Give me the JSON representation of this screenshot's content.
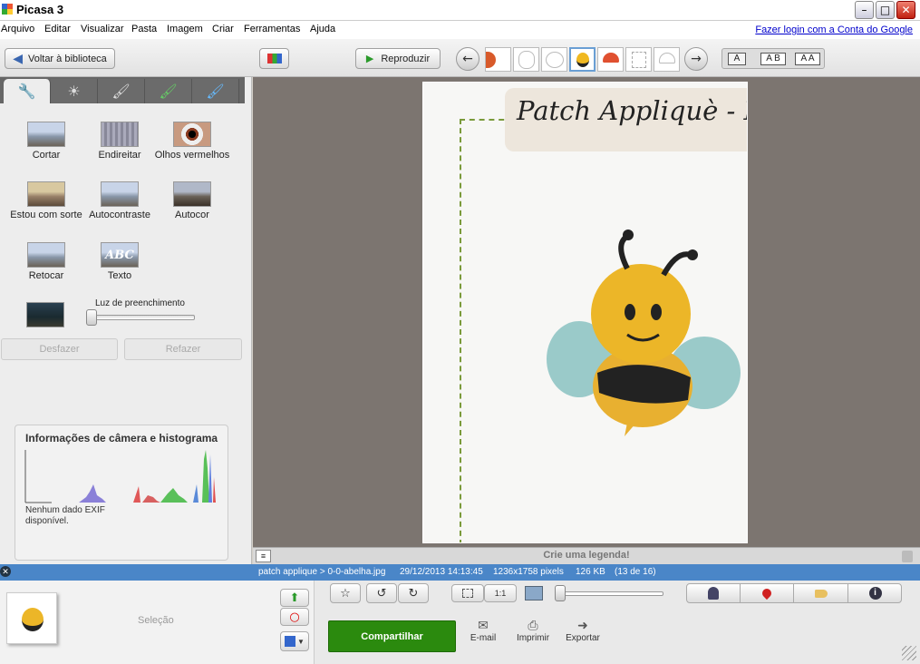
{
  "window": {
    "title": "Picasa 3",
    "min_label": "–",
    "max_label": "□",
    "close_label": "✕"
  },
  "menu": {
    "items": [
      "Arquivo",
      "Editar",
      "Visualizar",
      "Pasta",
      "Imagem",
      "Criar",
      "Ferramentas",
      "Ajuda"
    ],
    "login_link": "Fazer login com a Conta do Google"
  },
  "toolbar": {
    "back_label": "Voltar à biblioteca",
    "play_label": "Reproduzir",
    "layout_single": "A",
    "layout_double": "A B",
    "layout_compare": "A A"
  },
  "tools": {
    "tabs": [
      "wrench-icon",
      "sun-icon",
      "brush-icon",
      "green-brush-icon",
      "blue-brush-icon"
    ],
    "items": [
      "Cortar",
      "Endireitar",
      "Olhos vermelhos",
      "Estou com sorte",
      "Autocontraste",
      "Autocor",
      "Retocar",
      "Texto"
    ],
    "text_icon_label": "ABC",
    "fill_light_label": "Luz de preenchimento",
    "fill_light_value": 0,
    "undo_label": "Desfazer",
    "redo_label": "Refazer"
  },
  "histogram": {
    "title": "Informações de câmera e histograma",
    "no_exif": "Nenhum dado EXIF disponível."
  },
  "photo": {
    "header_text": "Patch Appliquè - Ma"
  },
  "caption": {
    "placeholder": "Crie uma legenda!"
  },
  "status": {
    "path": "patch applique > 0-0-abelha.jpg",
    "date": "29/12/2013 14:13:45",
    "dimensions": "1236x1758 pixels",
    "size": "126 KB",
    "position": "(13 de 16)",
    "close_label": "✕"
  },
  "bottom": {
    "selection_label": "Seleção",
    "share_label": "Compartilhar",
    "email_label": "E-mail",
    "print_label": "Imprimir",
    "export_label": "Exportar",
    "zoom_1to1": "1:1",
    "zoom_value": 0
  }
}
